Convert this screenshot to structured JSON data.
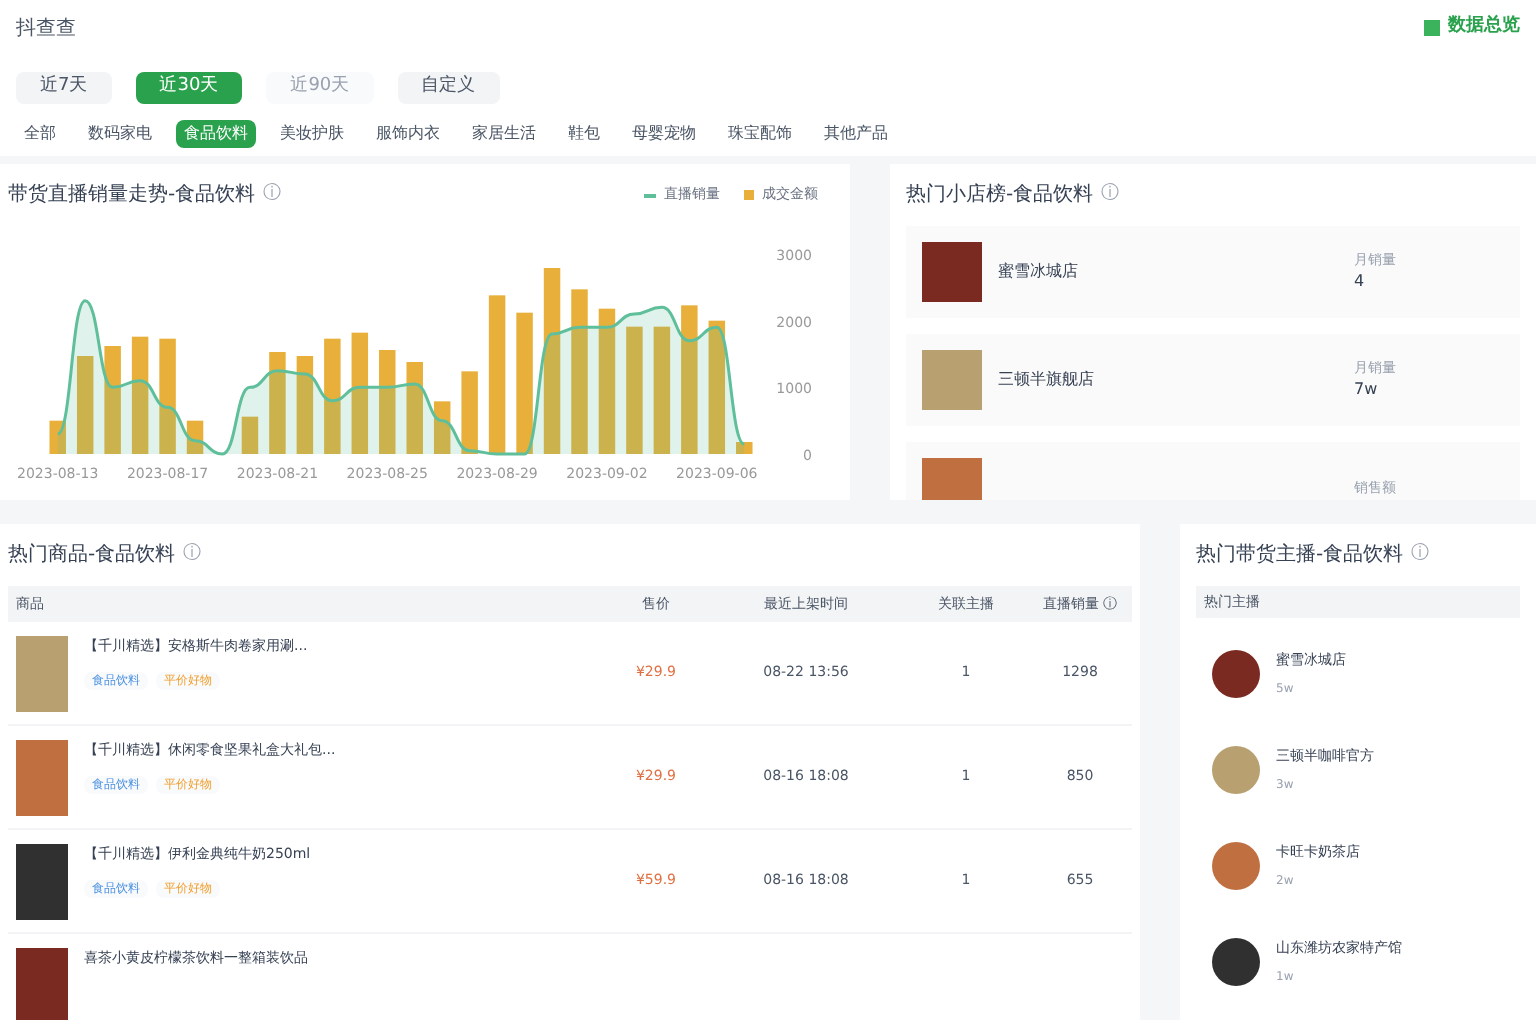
{
  "header": {
    "title": "抖查查",
    "action": "数据总览"
  },
  "period_buttons": [
    {
      "label": "近7天",
      "selected": false
    },
    {
      "label": "近30天",
      "selected": true
    },
    {
      "label": "近90天",
      "selected": false,
      "disabled": true
    },
    {
      "label": "自定义",
      "selected": false,
      "disabled": false
    }
  ],
  "category_tabs": [
    {
      "label": "全部",
      "selected": false
    },
    {
      "label": "数码家电",
      "selected": false
    },
    {
      "label": "食品饮料",
      "selected": true
    },
    {
      "label": "美妆护肤",
      "selected": false
    },
    {
      "label": "服饰内衣",
      "selected": false
    },
    {
      "label": "家居生活",
      "selected": false
    },
    {
      "label": "鞋包",
      "selected": false
    },
    {
      "label": "母婴宠物",
      "selected": false
    },
    {
      "label": "珠宝配饰",
      "selected": false
    },
    {
      "label": "其他产品",
      "selected": false
    }
  ],
  "trend_card": {
    "title": "带货直播销量走势-食品饮料",
    "info": "ⓘ",
    "chart_data": {
      "type": "bar",
      "categories": [
        "2023-08-13",
        null,
        null,
        null,
        "2023-08-17",
        null,
        null,
        null,
        "2023-08-21",
        null,
        null,
        null,
        "2023-08-25",
        null,
        null,
        null,
        "2023-08-29",
        null,
        null,
        null,
        "2023-09-02",
        null,
        null,
        null,
        "2023-09-06",
        null
      ],
      "series": [
        {
          "name": "成交金额",
          "color": "#e8b03a",
          "type": "bar",
          "values": [
            500,
            1470,
            1620,
            1760,
            1730,
            500,
            null,
            560,
            1530,
            1470,
            1730,
            1820,
            1560,
            1380,
            790,
            1240,
            2380,
            2120,
            2790,
            2470,
            2180,
            1910,
            1910,
            2230,
            2000,
            180
          ]
        },
        {
          "name": "直播销量",
          "color": "#5fbf9a",
          "type": "line",
          "values": [
            300,
            2300,
            1000,
            1100,
            700,
            200,
            0,
            1000,
            1250,
            1200,
            800,
            1000,
            1000,
            1050,
            500,
            50,
            0,
            0,
            1800,
            1900,
            1900,
            2100,
            2200,
            1700,
            1900,
            150
          ]
        }
      ],
      "yticks": [
        0,
        1000,
        2000,
        3000
      ],
      "ylim": [
        0,
        3000
      ]
    }
  },
  "shops_card": {
    "title": "热门小店榜-食品饮料",
    "info": "ⓘ",
    "rows": [
      {
        "name": "蜜雪冰城店",
        "metric_label": "月销量",
        "metric_value": "4"
      },
      {
        "name": "三顿半旗舰店",
        "metric_label": "月销量",
        "metric_value": "7w"
      },
      {
        "metric_label": "销售额"
      }
    ]
  },
  "products_card": {
    "title": "热门商品-食品饮料",
    "info": "ⓘ",
    "columns": [
      "商品",
      "售价",
      "最近上架时间",
      "关联主播",
      "直播销量 ⓘ"
    ],
    "rows": [
      {
        "title": "【千川精选】安格斯牛肉卷家用涮...",
        "tags": [
          {
            "label": "食品饮料",
            "color": "#4a90e2"
          },
          {
            "label": "平价好物",
            "color": "#f0a030"
          }
        ],
        "price": "¥29.9",
        "time": "08-22 13:56",
        "anchors": "1",
        "sales": "1298"
      },
      {
        "title": "【千川精选】休闲零食坚果礼盒大礼包...",
        "tags": [
          {
            "label": "食品饮料",
            "color": "#4a90e2"
          },
          {
            "label": "平价好物",
            "color": "#f0a030"
          }
        ],
        "price": "¥29.9",
        "time": "08-16 18:08",
        "anchors": "1",
        "sales": "850"
      },
      {
        "title": "【千川精选】伊利金典纯牛奶250ml",
        "tags": [
          {
            "label": "食品饮料",
            "color": "#4a90e2"
          },
          {
            "label": "平价好物",
            "color": "#f0a030"
          }
        ],
        "price": "¥59.9",
        "time": "08-16 18:08",
        "anchors": "1",
        "sales": "655"
      },
      {
        "title": "喜茶小黄皮柠檬茶饮料一整箱装饮品"
      }
    ]
  },
  "anchors_card": {
    "title": "热门带货主播-食品饮料",
    "info": "ⓘ",
    "header": "热门主播",
    "rows": [
      {
        "name": "蜜雪冰城店",
        "fans": "5w"
      },
      {
        "name": "三顿半咖啡官方",
        "fans": "3w"
      },
      {
        "name": "卡旺卡奶茶店",
        "fans": "2w"
      },
      {
        "name": "山东潍坊农家特产馆",
        "fans": "1w"
      }
    ]
  }
}
